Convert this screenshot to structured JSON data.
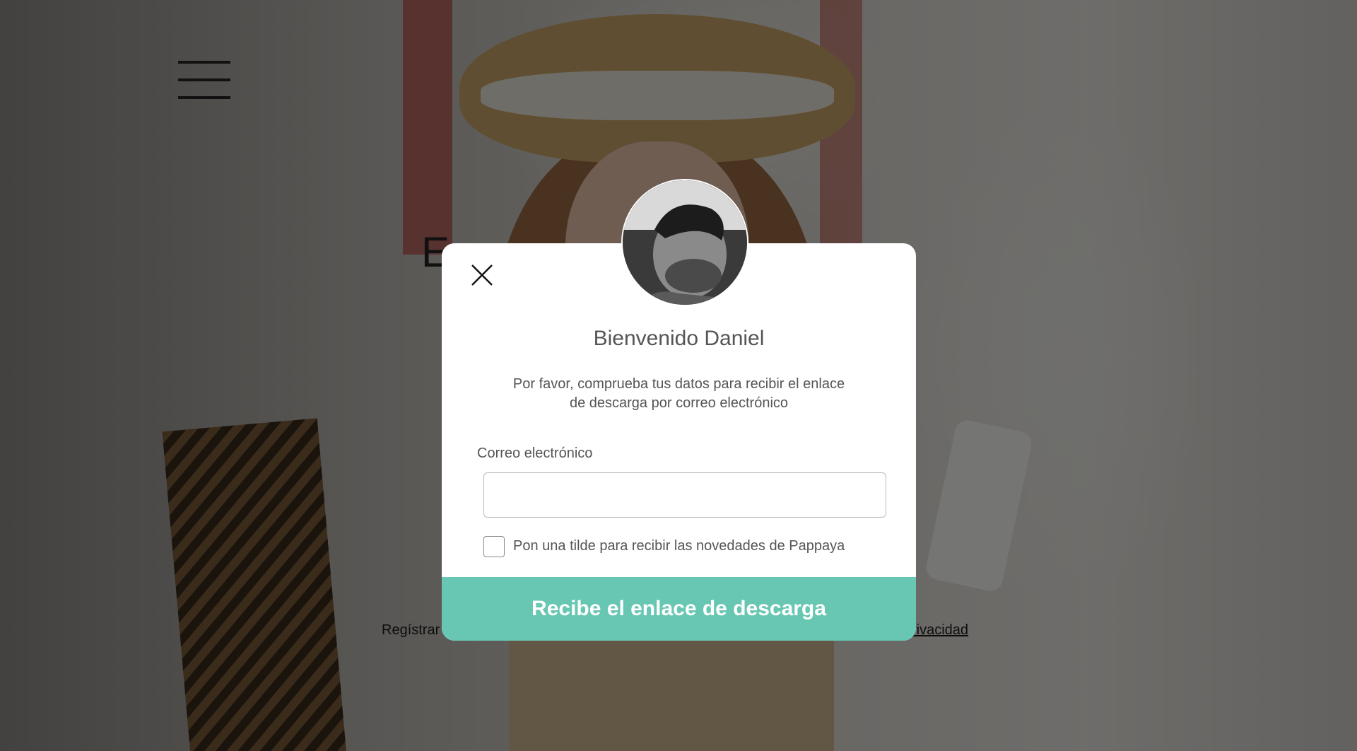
{
  "page": {
    "hero_title": "En … s",
    "register_text": "Regístrar",
    "privacy_link": "rivacidad"
  },
  "modal": {
    "title": "Bienvenido Daniel",
    "subtitle": "Por favor, comprueba tus datos para recibir el enlace de descarga por correo electrónico",
    "email_label": "Correo electrónico",
    "email_value": "",
    "email_placeholder": "",
    "checkbox_label": "Pon una tilde para recibir las novedades de Pappaya",
    "checkbox_checked": false,
    "submit_label": "Recibe el enlace de descarga"
  },
  "icons": {
    "menu": "hamburger-menu-icon",
    "close": "close-icon",
    "avatar": "user-avatar"
  },
  "colors": {
    "accent": "#68c7b3",
    "text": "#555555",
    "overlay": "rgba(0,0,0,0.52)"
  }
}
